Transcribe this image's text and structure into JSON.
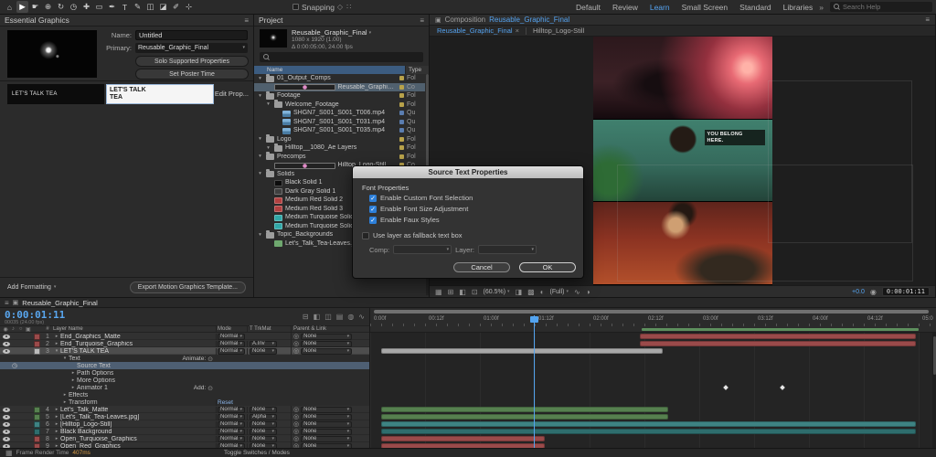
{
  "icons": {
    "menu": "≡",
    "caret": "▾",
    "twirl_open": "▾",
    "twirl_closed": "▸",
    "target": "⊙",
    "pick_whip": "◎",
    "stopwatch": "◷",
    "comp": "▣",
    "close": "×",
    "chevrons": "»",
    "check": "✓",
    "status_grid": "▦",
    "accent_blue": "#55a3f0"
  },
  "toolbar": {
    "snapping_label": "Snapping",
    "search_placeholder": "Search Help",
    "active_workspace": "Learn",
    "workspaces": [
      "Default",
      "Review",
      "Learn",
      "Small Screen",
      "Standard",
      "Libraries"
    ],
    "tools": [
      {
        "name": "home-icon",
        "glyph": "⌂"
      },
      {
        "name": "selection-tool-icon",
        "glyph": "▶"
      },
      {
        "name": "hand-tool-icon",
        "glyph": "☛"
      },
      {
        "name": "zoom-tool-icon",
        "glyph": "⊕"
      },
      {
        "name": "orbit-tool-icon",
        "glyph": "↻"
      },
      {
        "name": "rotation-tool-icon",
        "glyph": "◷"
      },
      {
        "name": "pan-behind-tool-icon",
        "glyph": "✚"
      },
      {
        "name": "shape-tool-icon",
        "glyph": "▭"
      },
      {
        "name": "pen-tool-icon",
        "glyph": "✒"
      },
      {
        "name": "type-tool-icon",
        "glyph": "T"
      },
      {
        "name": "brush-tool-icon",
        "glyph": "✎"
      },
      {
        "name": "clone-stamp-tool-icon",
        "glyph": "◫"
      },
      {
        "name": "eraser-tool-icon",
        "glyph": "◪"
      },
      {
        "name": "roto-brush-tool-icon",
        "glyph": "✐"
      },
      {
        "name": "puppet-pin-tool-icon",
        "glyph": "⊹"
      }
    ],
    "snap_icons": [
      {
        "name": "snap-edges-icon",
        "glyph": "◇"
      },
      {
        "name": "snap-features-icon",
        "glyph": "∷"
      }
    ]
  },
  "essential_graphics": {
    "title": "Essential Graphics",
    "name_label": "Name:",
    "name_value": "Untitled",
    "primary_label": "Primary:",
    "primary_value": "Reusable_Graphic_Final",
    "solo_button": "Solo Supported Properties",
    "poster_button": "Set Poster Time",
    "property_label": "LET'S TALK TEA",
    "property_value_line1": "LET'S TALK",
    "property_value_line2": "TEA",
    "edit_prop": "Edit Prop...",
    "add_formatting": "Add Formatting",
    "export_button": "Export Motion Graphics Template..."
  },
  "project": {
    "title": "Project",
    "info_name": "Reusable_Graphic_Final",
    "info_line2": "1080 x 1920 (1.00)",
    "info_line3": "Δ 0:00:05:00, 24.00 fps",
    "col_name": "Name",
    "col_type": "Type",
    "items": [
      {
        "indent": 0,
        "twirl": true,
        "icon": "folder",
        "name": "01_Output_Comps",
        "type": "Fol",
        "chip": "#b8a24a"
      },
      {
        "indent": 1,
        "icon": "comp",
        "name": "Reusable_Graphic_Final",
        "type": "Co",
        "selected": true,
        "chip": "#b8a24a"
      },
      {
        "indent": 0,
        "twirl": true,
        "icon": "folder",
        "name": "Footage",
        "type": "Fol",
        "chip": "#b8a24a"
      },
      {
        "indent": 1,
        "twirl": true,
        "icon": "folder",
        "name": "Welcome_Footage",
        "type": "Fol",
        "chip": "#b8a24a"
      },
      {
        "indent": 2,
        "icon": "footage",
        "name": "SHGN7_S001_S001_T006.mp4",
        "type": "Qu",
        "chip": "#5a7db0"
      },
      {
        "indent": 2,
        "icon": "footage",
        "name": "SHGN7_S001_S001_T031.mp4",
        "type": "Qu",
        "chip": "#5a7db0"
      },
      {
        "indent": 2,
        "icon": "footage",
        "name": "SHGN7_S001_S001_T035.mp4",
        "type": "Qu",
        "chip": "#5a7db0"
      },
      {
        "indent": 0,
        "twirl": true,
        "icon": "folder",
        "name": "Logo",
        "type": "Fol",
        "chip": "#b8a24a"
      },
      {
        "indent": 1,
        "twirl": true,
        "icon": "folder",
        "name": "Hilltop__1080_Ae Layers",
        "type": "Fol",
        "chip": "#b8a24a"
      },
      {
        "indent": 0,
        "twirl": true,
        "icon": "folder",
        "name": "Precomps",
        "type": "Fol",
        "chip": "#b8a24a"
      },
      {
        "indent": 1,
        "icon": "comp",
        "name": "Hilltop_Logo-Still",
        "type": "Co",
        "chip": "#b8a24a"
      },
      {
        "indent": 0,
        "twirl": true,
        "icon": "folder",
        "name": "Solids",
        "type": "Fol",
        "chip": "#b8a24a"
      },
      {
        "indent": 1,
        "icon": "solid",
        "color": "#0d0d0d",
        "name": "Black Solid 1",
        "type": "So",
        "chip": "#b8a24a"
      },
      {
        "indent": 1,
        "icon": "solid",
        "color": "#3f3f3f",
        "name": "Dark Gray Solid 1",
        "type": "So",
        "chip": "#b8a24a"
      },
      {
        "indent": 1,
        "icon": "solid",
        "color": "#b24040",
        "name": "Medium Red Solid 2",
        "type": "So",
        "chip": "#b24040"
      },
      {
        "indent": 1,
        "icon": "solid",
        "color": "#b24040",
        "name": "Medium Red Solid 3",
        "type": "So",
        "chip": "#b24040"
      },
      {
        "indent": 1,
        "icon": "solid",
        "color": "#31a8a8",
        "name": "Medium Turquoise Solid",
        "type": "So",
        "chip": "#31a8a8"
      },
      {
        "indent": 1,
        "icon": "solid",
        "color": "#31a8a8",
        "name": "Medium Turquoise Solid",
        "type": "So",
        "chip": "#31a8a8"
      },
      {
        "indent": 0,
        "twirl": true,
        "icon": "folder",
        "name": "Topic_Backgrounds",
        "type": "Fol",
        "chip": "#b8a24a"
      },
      {
        "indent": 1,
        "icon": "image",
        "name": "Let's_Talk_Tea-Leaves.jpg",
        "type": "JP",
        "chip": "#7b68a8"
      }
    ]
  },
  "composition": {
    "panel_tab_prefix": "Composition",
    "panel_tab_comp": "Reusable_Graphic_Final",
    "viewer_tabs": [
      {
        "label": "Reusable_Graphic_Final",
        "active": true,
        "closable": true
      },
      {
        "label": "Hilltop_Logo-Still",
        "active": false
      }
    ],
    "overlay_text_line1": "YOU BELONG",
    "overlay_text_line2": "HERE.",
    "zoom": "(60.5%)",
    "resolution": "(Full)",
    "exposure": "+0.0",
    "timecode": "0:00:01:11",
    "bar_left_icons": [
      {
        "name": "preview-quality-icon",
        "glyph": "▦"
      },
      {
        "name": "grid-and-guides-icon",
        "glyph": "⊞"
      },
      {
        "name": "mask-visibility-icon",
        "glyph": "◧"
      },
      {
        "name": "region-of-interest-icon",
        "glyph": "⊡"
      }
    ],
    "bar_mid_icons": [
      {
        "name": "safe-margins-icon",
        "glyph": "◨"
      },
      {
        "name": "transparency-grid-icon",
        "glyph": "▩"
      },
      {
        "name": "show-channel-icon",
        "glyph": "◐"
      }
    ],
    "bar_right_icons": [
      {
        "name": "fast-previews-icon",
        "glyph": "∿"
      },
      {
        "name": "exposure-icon",
        "glyph": "◑"
      }
    ],
    "bar_tail_icons": [
      {
        "name": "camera-snapshot-icon",
        "glyph": "◉"
      }
    ]
  },
  "dialog": {
    "title": "Source Text Properties",
    "section": "Font Properties",
    "checkboxes": [
      {
        "label": "Enable Custom Font Selection",
        "checked": true
      },
      {
        "label": "Enable Font Size Adjustment",
        "checked": true
      },
      {
        "label": "Enable Faux Styles",
        "checked": true
      }
    ],
    "fallback": {
      "label": "Use layer as fallback text box",
      "checked": false
    },
    "comp_label": "Comp:",
    "layer_label": "Layer:",
    "cancel": "Cancel",
    "ok": "OK"
  },
  "timeline": {
    "tab": "Reusable_Graphic_Final",
    "timecode": "0:00:01:11",
    "timecode_sub": "00035 (24.00 fps)",
    "col_num": "#",
    "col_name": "Layer Name",
    "col_mode": "Mode",
    "col_trkmat": "T TrkMat",
    "col_parent": "Parent & Link",
    "ruler": [
      "0:00f",
      "00:12f",
      "01:00f",
      "01:12f",
      "02:00f",
      "02:12f",
      "03:00f",
      "03:12f",
      "04:00f",
      "04:12f",
      "05:0"
    ],
    "av_icons": [
      {
        "name": "video-column-icon",
        "glyph": "◉"
      },
      {
        "name": "audio-column-icon",
        "glyph": "♪"
      },
      {
        "name": "solo-column-icon",
        "glyph": "○"
      },
      {
        "name": "lock-column-icon",
        "glyph": "▣"
      }
    ],
    "mini_icons": [
      {
        "name": "comp-mini-flowchart-icon",
        "glyph": "⊟"
      },
      {
        "name": "draft-3d-icon",
        "glyph": "◧"
      },
      {
        "name": "hide-shy-layers-icon",
        "glyph": "◫"
      },
      {
        "name": "frame-blending-icon",
        "glyph": "▤"
      },
      {
        "name": "motion-blur-icon",
        "glyph": "◍"
      },
      {
        "name": "graph-editor-icon",
        "glyph": "∿"
      }
    ],
    "rows": [
      {
        "kind": "layer",
        "num": "1",
        "name": "End_Graphics_Matte",
        "twirl": "closed",
        "eye": true,
        "chip": "#9a4a4a",
        "mode": "Normal",
        "trkmat": "",
        "parent": "None",
        "bar": {
          "s": 48,
          "e": 97,
          "c": "#9a4a4a"
        }
      },
      {
        "kind": "layer",
        "num": "2",
        "name": "End_Turquoise_Graphics",
        "twirl": "closed",
        "eye": true,
        "chip": "#9a4a4a",
        "mode": "Normal",
        "trkmat": "A.Inv",
        "parent": "None",
        "bar": {
          "s": 48,
          "e": 97,
          "c": "#9a4a4a"
        }
      },
      {
        "kind": "layer",
        "num": "3",
        "name": "LET'S TALK TEA",
        "twirl": "open",
        "eye": true,
        "selected": true,
        "chip": "#bcbcbc",
        "mode": "Normal",
        "trkmat": "None",
        "parent": "None",
        "bar": {
          "s": 2,
          "e": 52,
          "c": "#a8a8a8"
        }
      },
      {
        "kind": "group",
        "name": "Text",
        "twirl": "open",
        "indent": 1,
        "right_label": "Animate:"
      },
      {
        "kind": "prop",
        "name": "Source Text",
        "indent": 2,
        "stopwatch": true,
        "highlighted": true
      },
      {
        "kind": "group",
        "name": "Path Options",
        "twirl": "closed",
        "indent": 2
      },
      {
        "kind": "group",
        "name": "More Options",
        "twirl": "closed",
        "indent": 2
      },
      {
        "kind": "group",
        "name": "Animator 1",
        "twirl": "closed",
        "indent": 2,
        "right_label": "Add:",
        "keyframes": [
          63,
          73
        ]
      },
      {
        "kind": "group",
        "name": "Effects",
        "twirl": "closed",
        "indent": 1
      },
      {
        "kind": "group",
        "name": "Transform",
        "twirl": "closed",
        "indent": 1,
        "reset": "Reset"
      },
      {
        "kind": "layer",
        "num": "4",
        "name": "Let's_Talk_Matte",
        "twirl": "closed",
        "eye": true,
        "chip": "#56804f",
        "mode": "Normal",
        "trkmat": "None",
        "parent": "None",
        "bar": {
          "s": 2,
          "e": 53,
          "c": "#56804f"
        }
      },
      {
        "kind": "layer",
        "num": "5",
        "name": "[Let's_Talk_Tea-Leaves.jpg]",
        "twirl": "closed",
        "eye": true,
        "chip": "#56804f",
        "mode": "Normal",
        "trkmat": "Alpha",
        "parent": "None",
        "bar": {
          "s": 2,
          "e": 53,
          "c": "#56804f"
        }
      },
      {
        "kind": "layer",
        "num": "6",
        "name": "[Hilltop_Logo-Still]",
        "twirl": "closed",
        "eye": true,
        "chip": "#3e8383",
        "mode": "Normal",
        "trkmat": "None",
        "parent": "None",
        "bar": {
          "s": 2,
          "e": 97,
          "c": "#3e8383"
        }
      },
      {
        "kind": "layer",
        "num": "7",
        "name": "Black Background",
        "twirl": "closed",
        "eye": true,
        "chip": "#2e6d6d",
        "mode": "Normal",
        "trkmat": "None",
        "parent": "None",
        "bar": {
          "s": 2,
          "e": 97,
          "c": "#2e6d6d"
        }
      },
      {
        "kind": "layer",
        "num": "8",
        "name": "Open_Turquoise_Graphics",
        "twirl": "closed",
        "eye": true,
        "chip": "#9a4a4a",
        "mode": "Normal",
        "trkmat": "None",
        "parent": "None",
        "bar": {
          "s": 2,
          "e": 31,
          "c": "#9a4a4a"
        }
      },
      {
        "kind": "layer",
        "num": "9",
        "name": "Open_Red_Graphics",
        "twirl": "closed",
        "eye": true,
        "chip": "#9a4a4a",
        "mode": "Normal",
        "trkmat": "None",
        "parent": "None",
        "bar": {
          "s": 2,
          "e": 31,
          "c": "#9a4a4a"
        }
      }
    ]
  },
  "statusbar": {
    "frame_render_label": "Frame Render Time",
    "frame_render_value": "407ms",
    "toggle_label": "Toggle Switches / Modes"
  }
}
